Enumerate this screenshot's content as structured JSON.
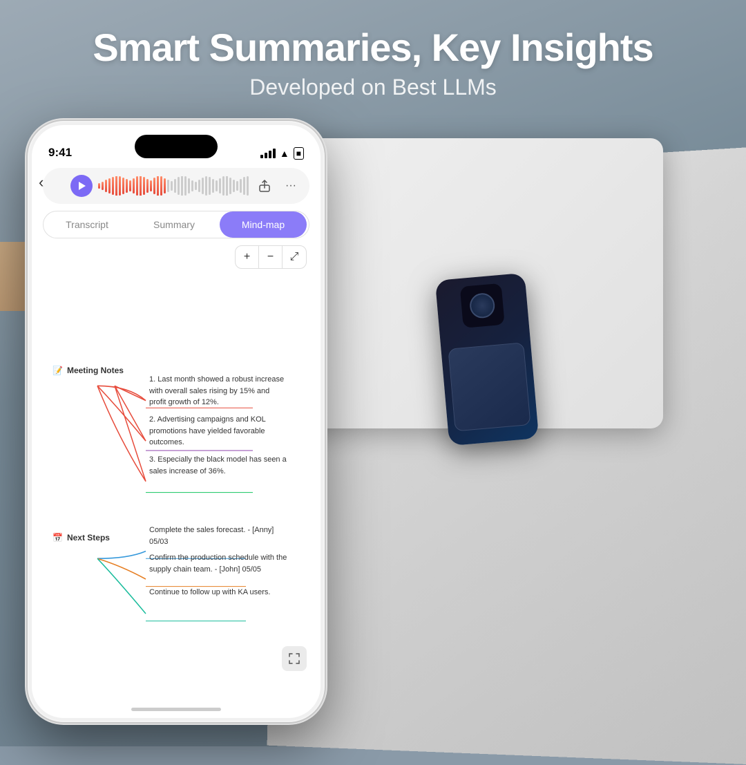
{
  "page": {
    "background_color": "#8a9aa8"
  },
  "header": {
    "main_title": "Smart Summaries, Key Insights",
    "subtitle": "Developed on Best LLMs"
  },
  "phone": {
    "status_bar": {
      "time": "9:41",
      "signal": "●●●●",
      "wifi": "wifi",
      "battery": "battery"
    },
    "tabs": [
      {
        "label": "Transcript",
        "active": false
      },
      {
        "label": "Summary",
        "active": false
      },
      {
        "label": "Mind-map",
        "active": true
      }
    ],
    "zoom_controls": [
      "+",
      "−",
      "⤢"
    ],
    "mindmap": {
      "node1": {
        "icon": "📝",
        "label": "Meeting Notes",
        "items": [
          "1. Last month showed a robust increase with overall sales rising by 15% and profit growth of 12%.",
          "2. Advertising campaigns and KOL promotions have yielded favorable outcomes.",
          "3. Especially the black model has seen a sales increase of 36%."
        ]
      },
      "node2": {
        "icon": "📅",
        "label": "Next Steps",
        "items": [
          "Complete the sales forecast. - [Anny] 05/03",
          "Confirm the production schedule with the supply chain team. - [John] 05/05",
          "Continue to follow up with KA users."
        ]
      }
    }
  }
}
